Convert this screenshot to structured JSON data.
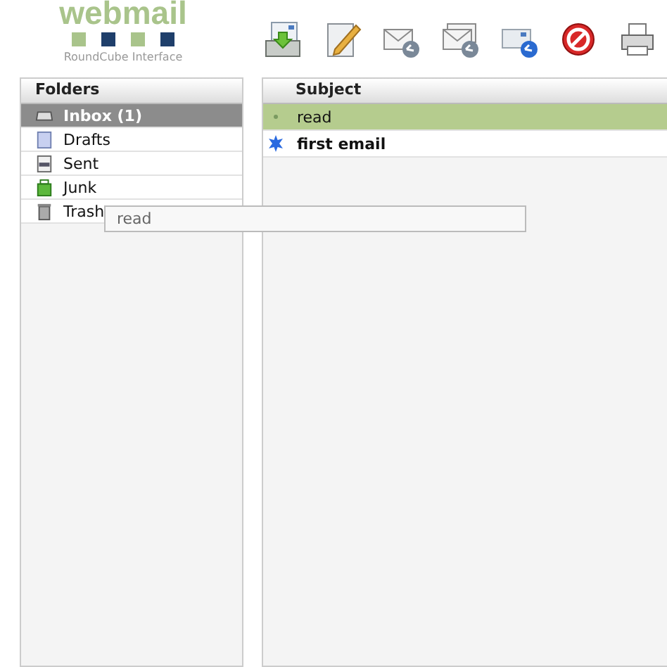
{
  "logo": {
    "title": "webmail",
    "subtitle": "RoundCube Interface"
  },
  "toolbar": [
    {
      "kind": "checkmail"
    },
    {
      "kind": "compose"
    },
    {
      "kind": "reply"
    },
    {
      "kind": "replyall"
    },
    {
      "kind": "forward"
    },
    {
      "kind": "delete"
    },
    {
      "kind": "print"
    }
  ],
  "folders": {
    "title": "Folders",
    "items": [
      {
        "label": "Inbox (1)",
        "kind": "inbox",
        "selected": true
      },
      {
        "label": "Drafts",
        "kind": "drafts",
        "selected": false
      },
      {
        "label": "Sent",
        "kind": "sent",
        "selected": false
      },
      {
        "label": "Junk",
        "kind": "junk",
        "selected": false
      },
      {
        "label": "Trash",
        "kind": "trash",
        "selected": false
      }
    ]
  },
  "messages": {
    "column": "Subject",
    "rows": [
      {
        "subject": "read",
        "unread": false,
        "selected": true
      },
      {
        "subject": "first email",
        "unread": true,
        "selected": false
      }
    ]
  },
  "drag_tooltip": "read"
}
